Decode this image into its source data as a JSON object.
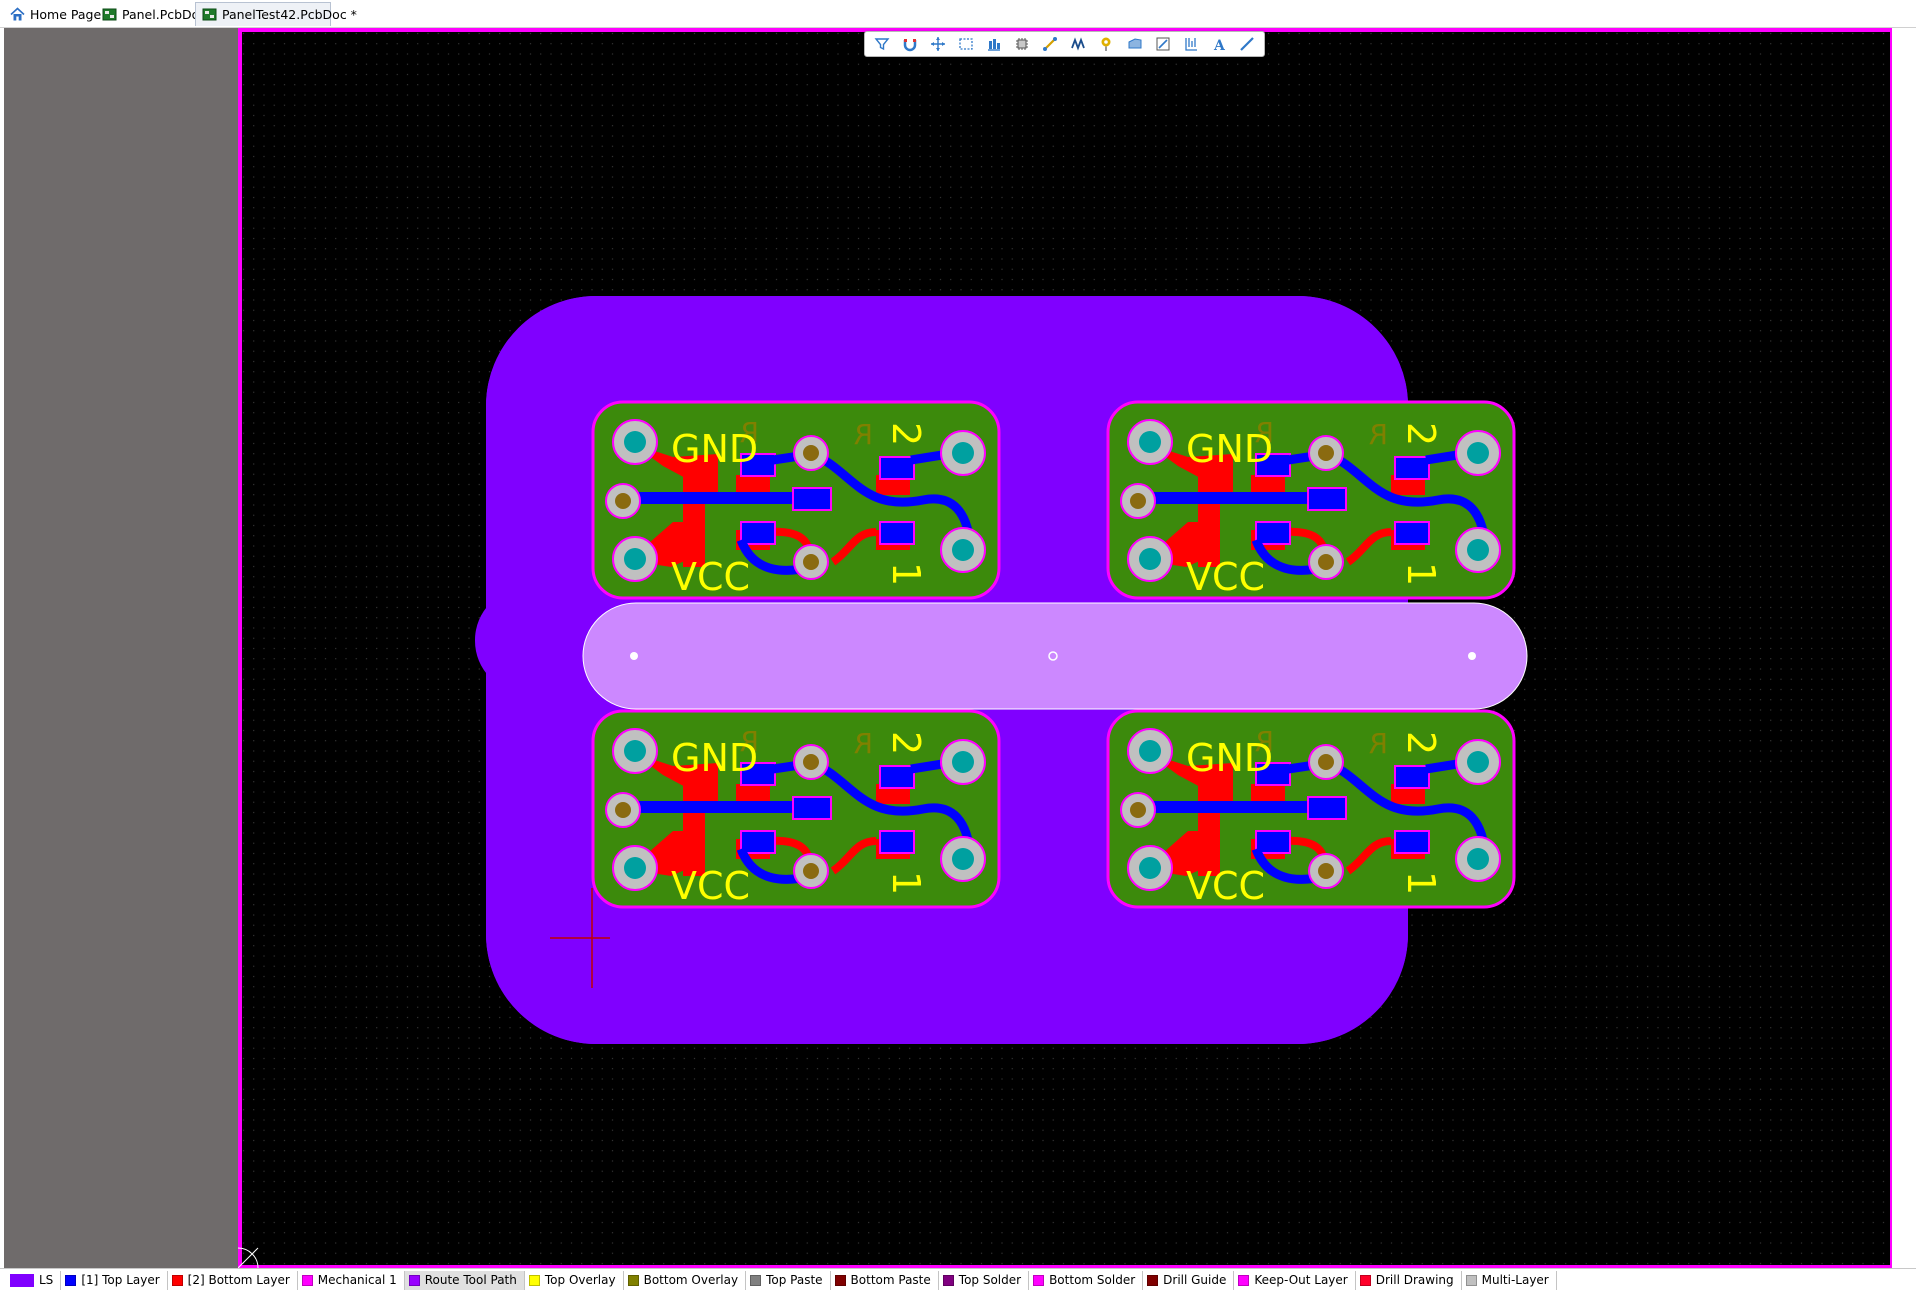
{
  "tabs": [
    {
      "label": "Home Page",
      "icon": "home-icon",
      "active": false
    },
    {
      "label": "Panel.PcbDoc",
      "icon": "pcb-document-icon",
      "active": false
    },
    {
      "label": "PanelTest42.PcbDoc *",
      "icon": "pcb-document-icon",
      "active": true
    }
  ],
  "toolbar": {
    "tools": [
      "filter-icon",
      "snap-magnet-icon",
      "move-cross-icon",
      "select-rect-icon",
      "align-icon",
      "place-component-icon",
      "interactive-route-icon",
      "differential-pair-icon",
      "place-via-icon",
      "polygon-pour-icon",
      "place-line-icon",
      "dimension-icon",
      "place-text-icon",
      "place-track-icon"
    ]
  },
  "board": {
    "boards": [
      {
        "label_top": "GND",
        "label_bottom": "VCC",
        "pin2": "2",
        "pin1": "1"
      },
      {
        "label_top": "GND",
        "label_bottom": "VCC",
        "pin2": "2",
        "pin1": "1"
      },
      {
        "label_top": "GND",
        "label_bottom": "VCC",
        "pin2": "2",
        "pin1": "1"
      },
      {
        "label_top": "GND",
        "label_bottom": "VCC",
        "pin2": "2",
        "pin1": "1"
      }
    ],
    "mirrored_designator": "R"
  },
  "layers": {
    "set_label": "LS",
    "set_color": "#8000ff",
    "items": [
      {
        "label": "[1] Top Layer",
        "color": "#0000ff"
      },
      {
        "label": "[2] Bottom Layer",
        "color": "#ff0000"
      },
      {
        "label": "Mechanical 1",
        "color": "#ff00ff"
      },
      {
        "label": "Route Tool Path",
        "color": "#9900ff",
        "active": true
      },
      {
        "label": "Top Overlay",
        "color": "#ffff00"
      },
      {
        "label": "Bottom Overlay",
        "color": "#808000"
      },
      {
        "label": "Top Paste",
        "color": "#808080"
      },
      {
        "label": "Bottom Paste",
        "color": "#800000"
      },
      {
        "label": "Top Solder",
        "color": "#800080"
      },
      {
        "label": "Bottom Solder",
        "color": "#ff00ff"
      },
      {
        "label": "Drill Guide",
        "color": "#800000"
      },
      {
        "label": "Keep-Out Layer",
        "color": "#ff00ff"
      },
      {
        "label": "Drill Drawing",
        "color": "#ff002a"
      },
      {
        "label": "Multi-Layer",
        "color": "#c0c0c0"
      }
    ]
  },
  "colors": {
    "background": "#000000",
    "route_tool_path": "#8000ff",
    "board_fill": "#3c8a0c",
    "top_copper": "#0000ff",
    "bottom_copper": "#ff0000",
    "overlay": "#ffff00",
    "keepout": "#ff00ff",
    "pad": "#c0c0c0",
    "drill": "#00a0a0"
  }
}
